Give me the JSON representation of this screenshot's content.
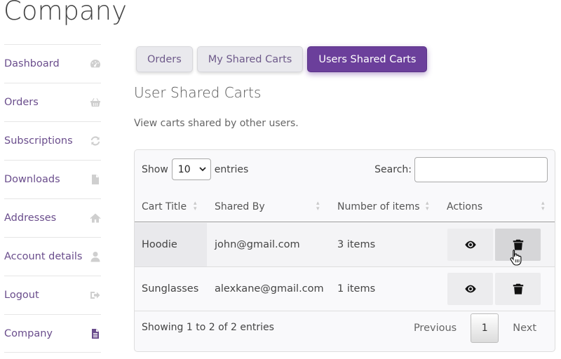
{
  "page": {
    "title": "Company"
  },
  "sidebar": {
    "items": [
      {
        "label": "Dashboard",
        "icon": "dashboard-icon"
      },
      {
        "label": "Orders",
        "icon": "basket-icon"
      },
      {
        "label": "Subscriptions",
        "icon": "refresh-icon"
      },
      {
        "label": "Downloads",
        "icon": "file-download-icon"
      },
      {
        "label": "Addresses",
        "icon": "home-icon"
      },
      {
        "label": "Account details",
        "icon": "user-icon"
      },
      {
        "label": "Logout",
        "icon": "sign-out-icon"
      },
      {
        "label": "Company",
        "icon": "document-icon",
        "active": true
      }
    ]
  },
  "tabs": [
    {
      "label": "Orders"
    },
    {
      "label": "My Shared Carts"
    },
    {
      "label": "Users Shared Carts",
      "active": true
    }
  ],
  "section": {
    "title": "User Shared Carts",
    "description": "View carts shared by other users."
  },
  "table": {
    "length_prefix": "Show",
    "length_value": "10",
    "length_suffix": "entries",
    "search_label": "Search:",
    "search_value": "",
    "columns": [
      "Cart Title",
      "Shared By",
      "Number of items",
      "Actions"
    ],
    "rows": [
      {
        "title": "Hoodie",
        "shared_by": "john@gmail.com",
        "items": "3 items"
      },
      {
        "title": "Sunglasses",
        "shared_by": "alexkane@gmail.com",
        "items": "1 items"
      }
    ],
    "info": "Showing 1 to 2 of 2 entries",
    "pagination": {
      "previous": "Previous",
      "current": "1",
      "next": "Next"
    }
  },
  "colors": {
    "accent": "#6b3f9b",
    "link": "#6a4d8c",
    "icon_muted": "#cfcfcf"
  }
}
